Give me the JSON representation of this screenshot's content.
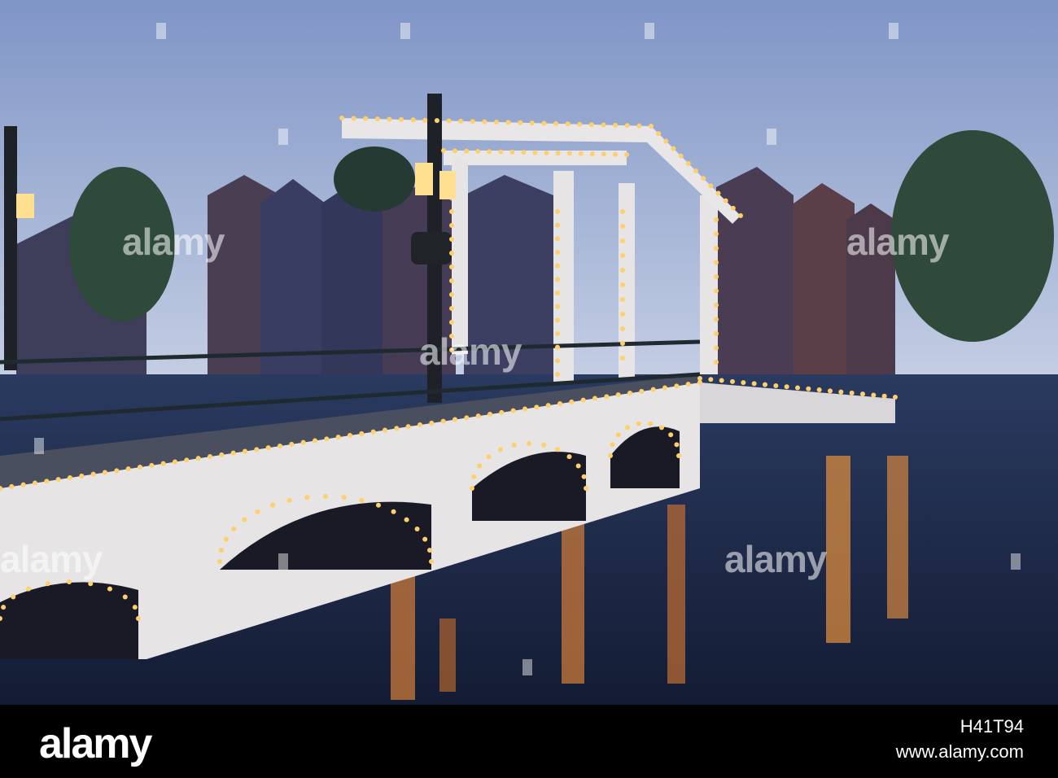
{
  "photo": {
    "subject": "Magere Brug drawbridge over the Amstel at dusk, Amsterdam",
    "colors": {
      "sky_top": "#7f95c6",
      "sky_bottom": "#c3cde3",
      "water": "#1a2440",
      "bridge_white": "#e6e4e4",
      "bulb": "#ffcf6a"
    }
  },
  "watermarks": [
    {
      "text": "alamy"
    },
    {
      "text": "alamy"
    },
    {
      "text": "alamy"
    },
    {
      "text": "alamy"
    },
    {
      "text": "alamy"
    }
  ],
  "footer": {
    "logo": "alamy",
    "image_id": "H41T94",
    "url": "www.alamy.com"
  }
}
